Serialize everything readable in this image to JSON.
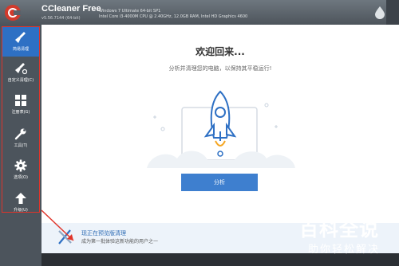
{
  "header": {
    "app_name": "CCleaner Free",
    "app_version": "v5.56.7144 (64-bit)",
    "system_line1": "Windows 7 Ultimate 64-bit SP1",
    "system_line2": "Intel Core i3-4000M CPU @ 2.40GHz, 12.0GB RAM, Intel HD Graphics 4600"
  },
  "sidebar": {
    "items": [
      {
        "label": "简易清理",
        "icon": "broom-icon",
        "active": true
      },
      {
        "label": "自定义清理(C)",
        "icon": "custom-clean-icon"
      },
      {
        "label": "注册表(G)",
        "icon": "grid-icon"
      },
      {
        "label": "工具(T)",
        "icon": "wrench-icon"
      },
      {
        "label": "选项(O)",
        "icon": "gear-icon"
      },
      {
        "label": "升级(U)",
        "icon": "arrow-up-icon"
      }
    ]
  },
  "main": {
    "welcome": "欢迎回来...",
    "subtitle": "分析并清理您的电脑，以保持其平稳运行!",
    "analyze_button": "分析"
  },
  "promo": {
    "title": "现正在预览版清理",
    "desc": "成为第一批体验这新功能的用户之一"
  },
  "watermark": {
    "title": "百科全说",
    "subtitle": "助你轻松解决"
  },
  "colors": {
    "accent": "#2e70c4",
    "annotation": "#e0342a",
    "sidebar_bg": "#4c545c"
  }
}
